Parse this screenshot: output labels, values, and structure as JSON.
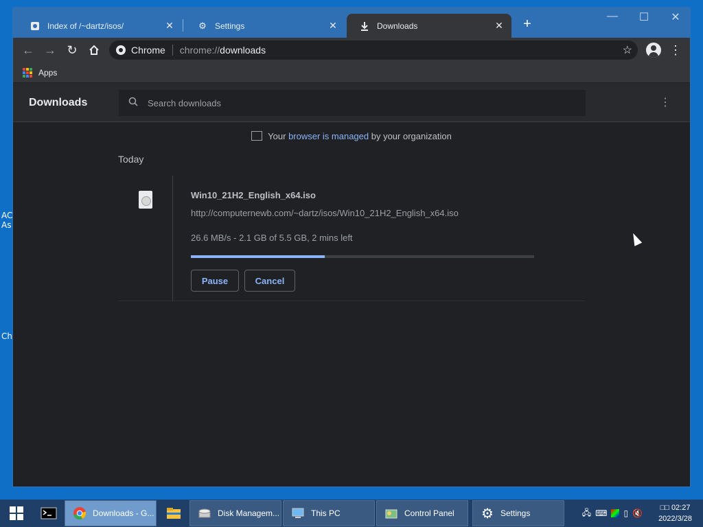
{
  "desktop": {
    "edge_labels": [
      "AC",
      "As",
      "Ch"
    ]
  },
  "browser": {
    "tabs": [
      {
        "title": "Index of /~dartz/isos/",
        "icon": "server-icon",
        "active": false
      },
      {
        "title": "Settings",
        "icon": "gear-icon",
        "active": false
      },
      {
        "title": "Downloads",
        "icon": "download-icon",
        "active": true
      }
    ],
    "window_controls": {
      "minimize": "—",
      "maximize": "☐",
      "close": "✕"
    },
    "omnibox": {
      "chip": "Chrome",
      "url_scheme": "chrome://",
      "url_path": "downloads"
    },
    "bookmarks": {
      "apps_label": "Apps"
    }
  },
  "downloads_page": {
    "title": "Downloads",
    "search_placeholder": "Search downloads",
    "managed_prefix": "Your ",
    "managed_link": "browser is managed",
    "managed_suffix": " by your organization",
    "section_label": "Today",
    "item": {
      "filename": "Win10_21H2_English_x64.iso",
      "url": "http://computernewb.com/~dartz/isos/Win10_21H2_English_x64.iso",
      "status": "26.6 MB/s - 2.1 GB of 5.5 GB, 2 mins left",
      "progress_fraction": 0.39,
      "pause_label": "Pause",
      "cancel_label": "Cancel"
    }
  },
  "taskbar": {
    "tasks": [
      {
        "label": "Downloads - G...",
        "icon": "chrome-icon",
        "active": true
      },
      {
        "label": "Disk Managem...",
        "icon": "disk-management-icon",
        "active": false
      },
      {
        "label": "This PC",
        "icon": "this-pc-icon",
        "active": false
      },
      {
        "label": "Control Panel",
        "icon": "control-panel-icon",
        "active": false
      },
      {
        "label": "Settings",
        "icon": "gear-icon",
        "active": false
      }
    ],
    "clock": {
      "time": "□□ 02:27",
      "date": "2022/3/28"
    }
  },
  "colors": {
    "accent": "#8ab4f8",
    "titlebar": "#2f6fb3",
    "page_bg": "#202124"
  }
}
